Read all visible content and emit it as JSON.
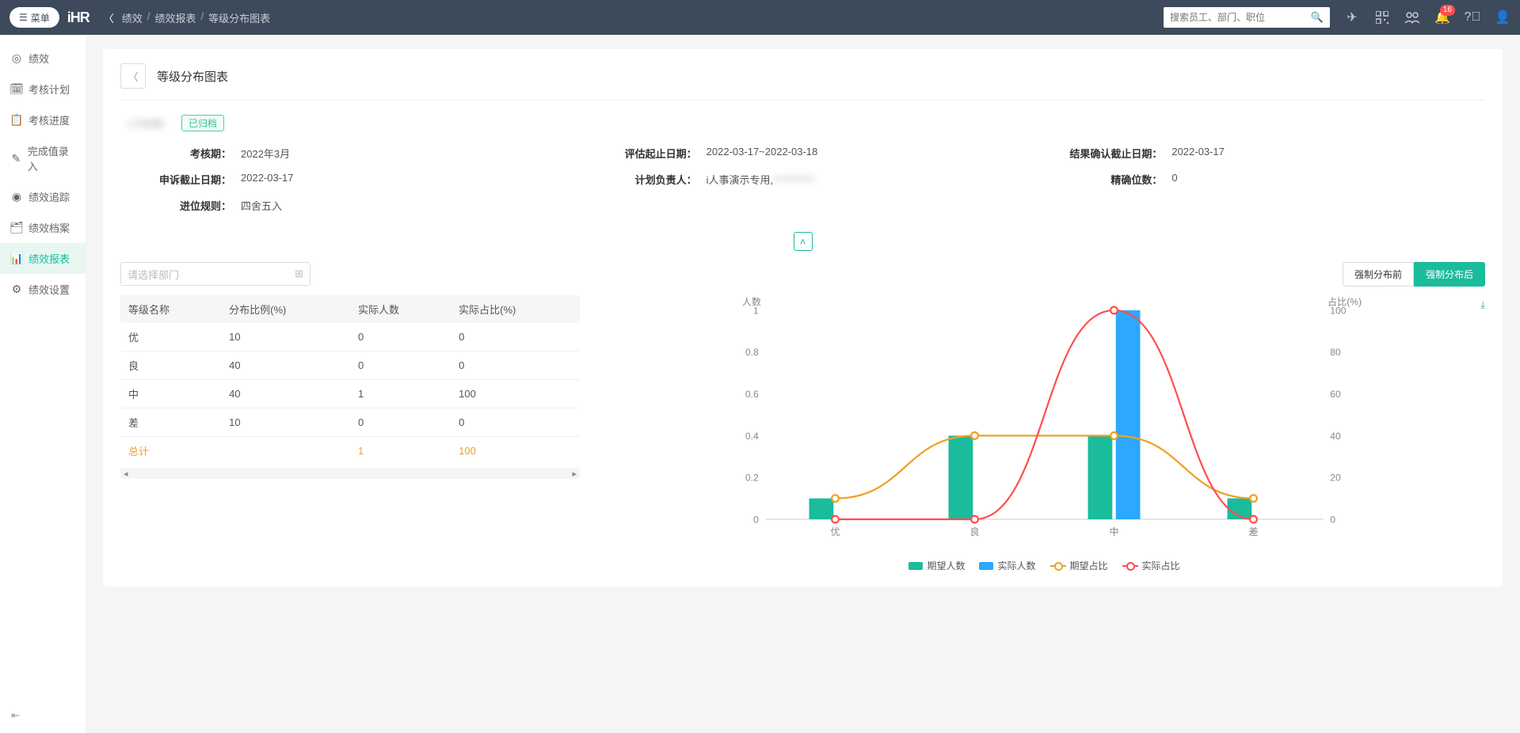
{
  "topbar": {
    "menu_label": "菜单",
    "logo": "iHR",
    "breadcrumb": [
      "绩效",
      "绩效报表",
      "等级分布图表"
    ],
    "search_placeholder": "搜索员工、部门、职位",
    "notification_count": "16"
  },
  "sidebar": {
    "items": [
      {
        "label": "绩效",
        "icon": "target"
      },
      {
        "label": "考核计划",
        "icon": "calendar"
      },
      {
        "label": "考核进度",
        "icon": "clipboard"
      },
      {
        "label": "完成值录入",
        "icon": "edit"
      },
      {
        "label": "绩效追踪",
        "icon": "radar"
      },
      {
        "label": "绩效档案",
        "icon": "archive"
      },
      {
        "label": "绩效报表",
        "icon": "chart"
      },
      {
        "label": "绩效设置",
        "icon": "gear"
      }
    ],
    "active_index": 6
  },
  "page": {
    "title": "等级分布图表",
    "plan_name": "（已隐藏）",
    "status_tag": "已归档",
    "info": {
      "period_label": "考核期：",
      "period_value": "2022年3月",
      "appeal_label": "申诉截止日期：",
      "appeal_value": "2022-03-17",
      "rounding_label": "进位规则：",
      "rounding_value": "四舍五入",
      "eval_label": "评估起止日期：",
      "eval_value": "2022-03-17~2022-03-18",
      "owner_label": "计划负责人：",
      "owner_value": "i人事演示专用,",
      "confirm_label": "结果确认截止日期：",
      "confirm_value": "2022-03-17",
      "precision_label": "精确位数：",
      "precision_value": "0"
    }
  },
  "table": {
    "dept_placeholder": "请选择部门",
    "columns": [
      "等级名称",
      "分布比例(%)",
      "实际人数",
      "实际占比(%)"
    ],
    "rows": [
      {
        "name": "优",
        "ratio": "10",
        "actual": "0",
        "pct": "0"
      },
      {
        "name": "良",
        "ratio": "40",
        "actual": "0",
        "pct": "0"
      },
      {
        "name": "中",
        "ratio": "40",
        "actual": "1",
        "pct": "100"
      },
      {
        "name": "差",
        "ratio": "10",
        "actual": "0",
        "pct": "0"
      }
    ],
    "total": {
      "label": "总计",
      "actual": "1",
      "pct": "100"
    }
  },
  "chart_tabs": {
    "before": "强制分布前",
    "after": "强制分布后",
    "active": "after"
  },
  "chart_data": {
    "type": "bar",
    "categories": [
      "优",
      "良",
      "中",
      "差"
    ],
    "y_left_label": "人数",
    "y_right_label": "占比(%)",
    "y_left_ticks": [
      0,
      0.2,
      0.4,
      0.6,
      0.8,
      1
    ],
    "y_right_ticks": [
      0,
      20,
      40,
      60,
      80,
      100
    ],
    "series": [
      {
        "name": "期望人数",
        "type": "bar",
        "color": "#1abc9c",
        "values": [
          0.1,
          0.4,
          0.4,
          0.1
        ]
      },
      {
        "name": "实际人数",
        "type": "bar",
        "color": "#2ca8ff",
        "values": [
          0,
          0,
          1,
          0
        ]
      },
      {
        "name": "期望占比",
        "type": "line",
        "color": "#f0a020",
        "values": [
          10,
          40,
          40,
          10
        ]
      },
      {
        "name": "实际占比",
        "type": "line",
        "color": "#ff4d4f",
        "values": [
          0,
          0,
          100,
          0
        ]
      }
    ],
    "legend": [
      "期望人数",
      "实际人数",
      "期望占比",
      "实际占比"
    ]
  }
}
